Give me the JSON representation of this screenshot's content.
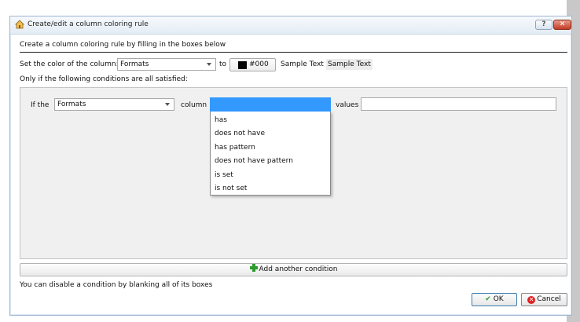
{
  "window": {
    "title": "Create/edit a column coloring rule",
    "help_label": "?",
    "close_label": "✕"
  },
  "intro": "Create a column coloring rule by filling in the boxes below",
  "color_row": {
    "prefix": "Set the  color  of the column:",
    "column_value": "Formats",
    "to_label": "to",
    "color_value": "#000",
    "color_hex": "#000000",
    "sample_text_1": "Sample Text",
    "sample_text_2": "Sample Text"
  },
  "conditions_label": "Only if the following conditions are all satisfied:",
  "condition": {
    "if_label": "If the",
    "field_value": "Formats",
    "column_label": "column",
    "operator_value": "",
    "values_label": "values",
    "values_value": ""
  },
  "operator_options": [
    "has",
    "does not have",
    "has pattern",
    "does not have pattern",
    "is set",
    "is not set"
  ],
  "add_condition_label": "Add another condition",
  "hint": "You can disable a condition by blanking all of its boxes",
  "buttons": {
    "ok": "OK",
    "cancel": "Cancel"
  }
}
